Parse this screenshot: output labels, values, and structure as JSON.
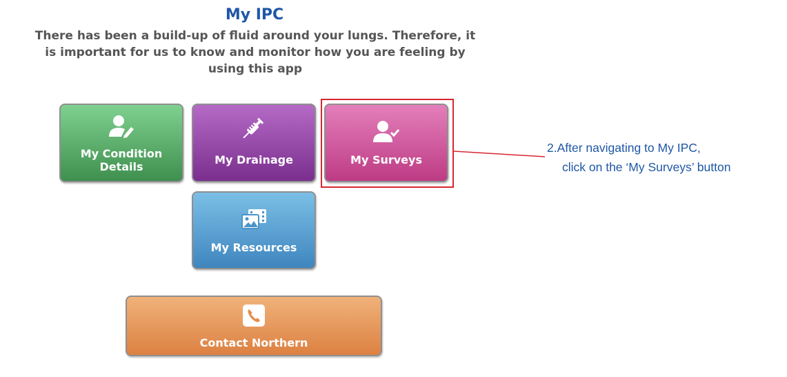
{
  "page": {
    "title": "My IPC",
    "intro": "There has been a build-up of fluid around your lungs. Therefore, it is important for us to know and monitor how you are feeling by using this app"
  },
  "tiles": [
    {
      "label": "My Condition Details",
      "icon": "user-edit-icon",
      "color": "#4f9f5e"
    },
    {
      "label": "My Drainage",
      "icon": "syringe-icon",
      "color": "#8e3a9f"
    },
    {
      "label": "My Surveys",
      "icon": "user-check-icon",
      "color": "#c84a8f"
    },
    {
      "label": "My Resources",
      "icon": "photo-film-icon",
      "color": "#4a93c9"
    },
    {
      "label": "Contact Northern",
      "icon": "phone-icon",
      "color": "#e58e4d"
    }
  ],
  "annotation": {
    "line1": "2.After navigating to My IPC,",
    "line2": "click on the ‘My Surveys’ button",
    "highlight_color": "#d8262f"
  }
}
